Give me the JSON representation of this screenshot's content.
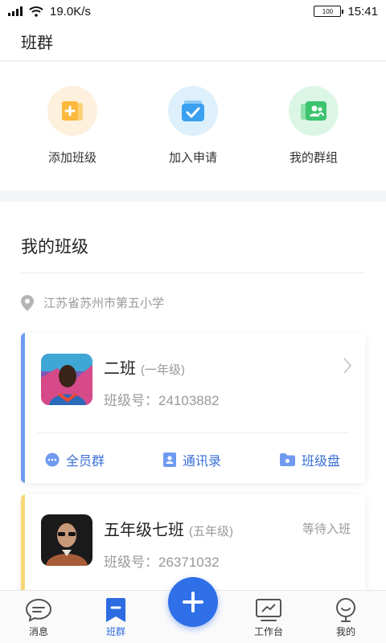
{
  "status_bar": {
    "network_speed": "19.0K/s",
    "battery_level": "100",
    "time": "15:41"
  },
  "header": {
    "title": "班群"
  },
  "shortcuts": [
    {
      "label": "添加班级",
      "icon": "add-class-icon",
      "color": "#fdb83e"
    },
    {
      "label": "加入申请",
      "icon": "join-request-icon",
      "color": "#3aa0ef"
    },
    {
      "label": "我的群组",
      "icon": "my-groups-icon",
      "color": "#3cc46f"
    }
  ],
  "section": {
    "title": "我的班级",
    "location": "江苏省苏州市第五小学"
  },
  "classes": [
    {
      "name": "二班",
      "grade": "(一年级)",
      "class_no": "班级号：24103882",
      "accent": "#6f9af0",
      "actions": [
        {
          "label": "全员群",
          "icon": "chat-icon"
        },
        {
          "label": "通讯录",
          "icon": "contacts-icon"
        },
        {
          "label": "班级盘",
          "icon": "folder-icon"
        }
      ]
    },
    {
      "name": "五年级七班",
      "grade": "(五年级)",
      "class_no": "班级号：26371032",
      "status": "等待入班",
      "accent": "#f7d774"
    }
  ],
  "tabbar": {
    "tabs": [
      "消息",
      "班群",
      "工作台",
      "我的"
    ],
    "active": "班群"
  }
}
